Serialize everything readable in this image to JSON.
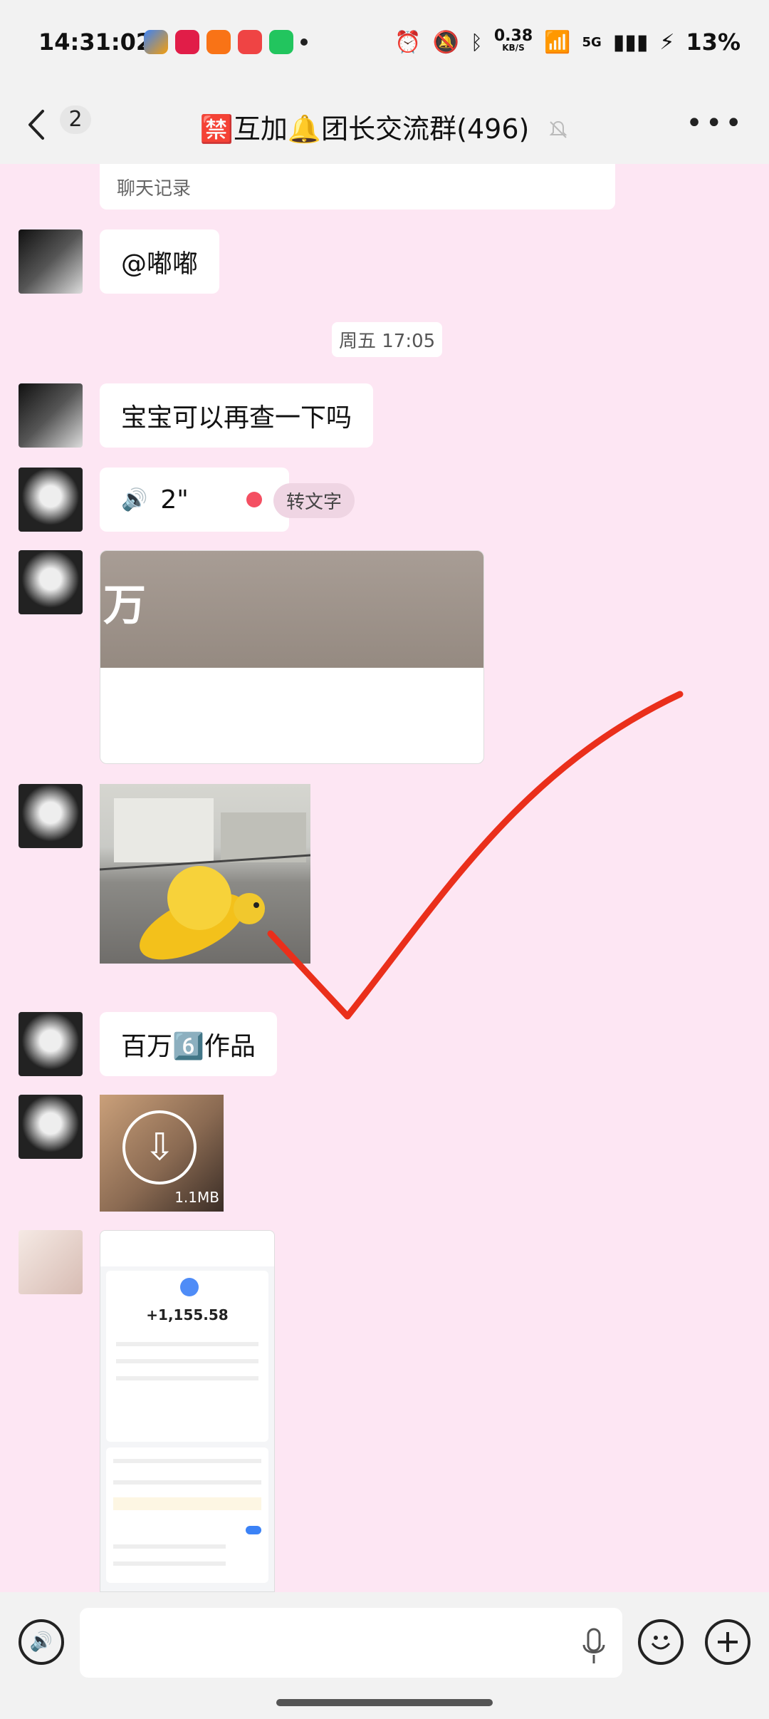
{
  "status": {
    "time": "14:31:02",
    "net_speed_value": "0.38",
    "net_speed_unit": "KB/S",
    "network": "5G",
    "battery": "13%"
  },
  "header": {
    "unread": "2",
    "title": "🈲互加🔔团长交流群(496)"
  },
  "messages": {
    "chat_record_label": "聊天记录",
    "mention": "@嘟嘟",
    "timestamp": "周五 17:05",
    "text1": "宝宝可以再查一下吗",
    "voice_duration": "2\"",
    "to_text_label": "转文字",
    "image_caption": "万",
    "text2": "百万6️⃣作品",
    "video_size": "1.1MB",
    "receipt": {
      "amount": "+1,155.58"
    }
  }
}
